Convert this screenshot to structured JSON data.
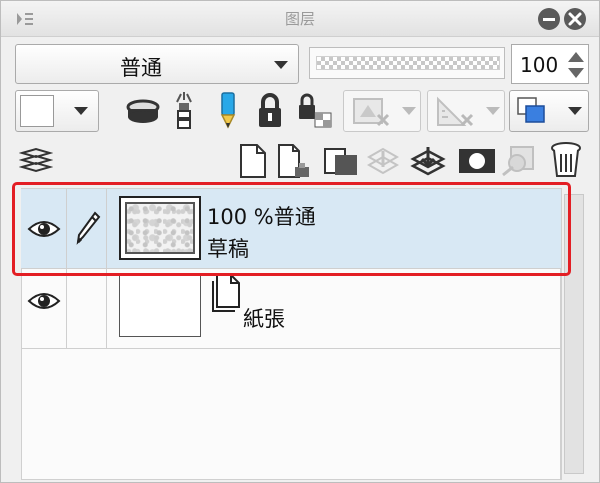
{
  "window": {
    "title": "图层"
  },
  "toolbar": {
    "blend_mode": "普通",
    "opacity_value": "100"
  },
  "layers": [
    {
      "opacity": "100 %",
      "blend": "普通",
      "name": "草稿",
      "selected": true
    },
    {
      "name": "紙張",
      "selected": false
    }
  ],
  "icons": {
    "menu": "panel-menu-icon",
    "minimize": "minimize-icon",
    "close": "close-icon",
    "eye": "eye-icon",
    "pen": "pen-icon",
    "paper": "paper-layer-icon"
  },
  "colors": {
    "selection_highlight": "#e31e24",
    "selected_row": "#d8e8f4",
    "color_chip": "#3a7fe0"
  }
}
